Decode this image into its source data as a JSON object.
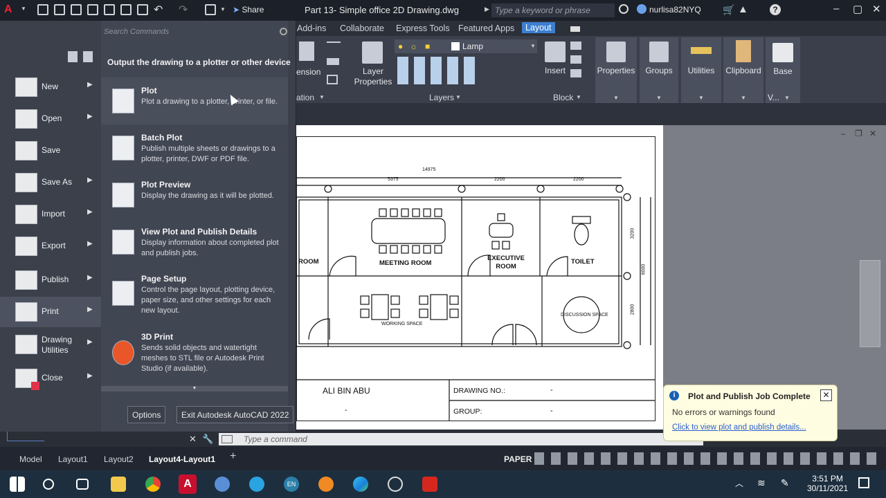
{
  "window": {
    "title": "Part 13- Simple office 2D Drawing.dwg",
    "search_placeholder": "Type a keyword or phrase",
    "user": "nurlisa82NYQ",
    "share_label": "Share"
  },
  "ribbon": {
    "tabs": [
      "Add-ins",
      "Collaborate",
      "Express Tools",
      "Featured Apps",
      "Layout"
    ],
    "active_tab": "Layout",
    "buttons": {
      "layer_properties": "Layer Properties",
      "insert": "Insert",
      "properties": "Properties",
      "groups": "Groups",
      "utilities": "Utilities",
      "clipboard": "Clipboard",
      "base": "Base",
      "layer_dropdown": "Lamp",
      "dimension_partial": "ension"
    },
    "groups": {
      "annotation_partial": "ation",
      "layers": "Layers",
      "block": "Block",
      "view_partial": "V..."
    }
  },
  "app_menu": {
    "search_placeholder": "Search Commands",
    "left_items": [
      {
        "label": "New",
        "arrow": true
      },
      {
        "label": "Open",
        "arrow": true
      },
      {
        "label": "Save",
        "arrow": false
      },
      {
        "label": "Save As",
        "arrow": true
      },
      {
        "label": "Import",
        "arrow": true
      },
      {
        "label": "Export",
        "arrow": true
      },
      {
        "label": "Publish",
        "arrow": true
      },
      {
        "label": "Print",
        "arrow": true
      },
      {
        "label": "Drawing Utilities",
        "arrow": true
      },
      {
        "label": "Close",
        "arrow": true
      }
    ],
    "selected_left": "Print",
    "heading": "Output the drawing to a plotter or other device",
    "right_items": [
      {
        "title": "Plot",
        "desc": "Plot a drawing to a plotter, printer, or file."
      },
      {
        "title": "Batch Plot",
        "desc": "Publish multiple sheets or drawings to a plotter, printer, DWF or PDF file."
      },
      {
        "title": "Plot Preview",
        "desc": "Display the drawing as it will be plotted."
      },
      {
        "title": "View Plot and Publish Details",
        "desc": "Display information about completed plot and publish jobs."
      },
      {
        "title": "Page Setup",
        "desc": "Control the page layout, plotting device, paper size, and other settings for each new layout."
      },
      {
        "title": "3D Print",
        "desc": "Sends solid objects and watertight meshes to STL file or Autodesk Print Studio (if available)."
      }
    ],
    "options_button": "Options",
    "exit_button": "Exit Autodesk AutoCAD 2022"
  },
  "drawing": {
    "rooms": {
      "room_partial": "ROOM",
      "meeting": "MEETING ROOM",
      "executive": "EXECUTIVE ROOM",
      "toilet": "TOILET",
      "working": "WORKING SPACE",
      "discussion": "DISCUSSION SPACE"
    },
    "dims": {
      "total": "14975",
      "d1": "5375",
      "d2": "2200",
      "d3": "2200",
      "v1": "3200",
      "v2": "2800",
      "vtotal": "6000"
    },
    "title_block": {
      "name": "ALI BIN ABU",
      "drawing_no_label": "DRAWING NO.:",
      "drawing_no": "-",
      "group_label": "GROUP:",
      "group": "-",
      "blank": "-"
    }
  },
  "command": {
    "placeholder": "Type a command"
  },
  "layout_tabs": [
    "Model",
    "Layout1",
    "Layout2",
    "Layout4-Layout1"
  ],
  "active_layout": "Layout4-Layout1",
  "status": {
    "paper": "PAPER"
  },
  "notification": {
    "title": "Plot and Publish Job Complete",
    "message": "No errors or warnings found",
    "link": "Click to view plot and publish details..."
  },
  "taskbar": {
    "time": "3:51 PM",
    "date": "30/11/2021",
    "lang": "EN"
  },
  "colors": {
    "accent": "#3c7fd1",
    "autocad_red": "#c8102e",
    "notif_bg": "#fffde1"
  }
}
